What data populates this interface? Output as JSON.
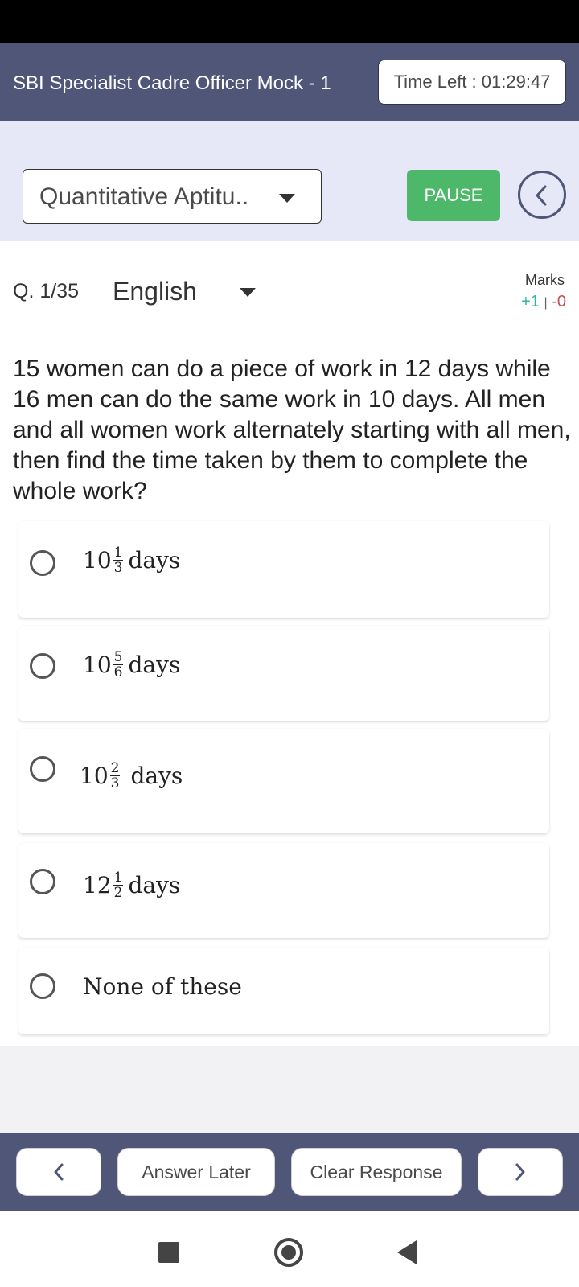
{
  "header": {
    "title": "SBI Specialist Cadre Officer Mock - 1",
    "timer": "Time Left : 01:29:47",
    "color": "#4f5677"
  },
  "section": {
    "selected": "Quantitative Aptitu..",
    "pause_label": "PAUSE",
    "pause_color": "#4db86a",
    "back_icon": "chevron-left-circle-icon"
  },
  "question": {
    "number": "Q. 1/35",
    "language": "English",
    "marks_label": "Marks",
    "marks_positive": "+1",
    "marks_separator": "|",
    "marks_negative": "-0",
    "text": "15 women can do a piece of work in 12 days while 16 men can do the same work in 10 days. All men and all women work alternately starting with all men, then find the time taken by them to complete the whole work?"
  },
  "options": [
    {
      "whole": "10",
      "num": "1",
      "den": "3",
      "unit": "days"
    },
    {
      "whole": "10",
      "num": "5",
      "den": "6",
      "unit": "days"
    },
    {
      "whole": "10",
      "num": "2",
      "den": "3",
      "unit": "days"
    },
    {
      "whole": "12",
      "num": "1",
      "den": "2",
      "unit": "days"
    },
    {
      "text": "None of these"
    }
  ],
  "footer": {
    "prev_icon": "chevron-left-icon",
    "answer_later": "Answer Later",
    "clear_response": "Clear Response",
    "next_icon": "chevron-right-icon"
  }
}
